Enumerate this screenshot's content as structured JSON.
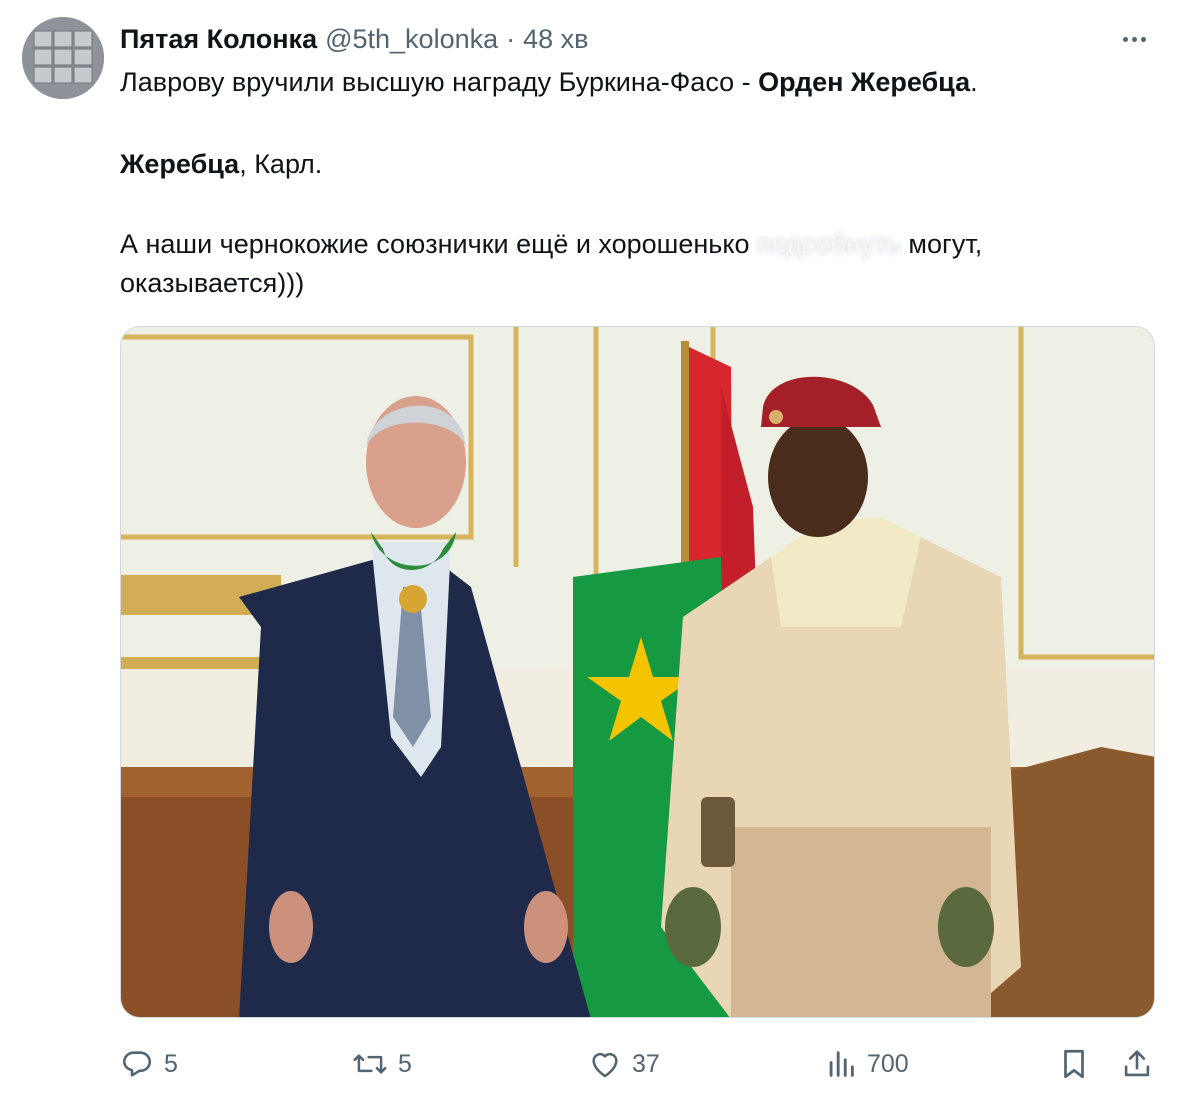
{
  "tweet": {
    "display_name": "Пятая Колонка",
    "handle": "@5th_kolonka",
    "separator": "·",
    "time": "48 хв",
    "line1_prefix": "Лаврову вручили высшую награду Буркина-Фасо - ",
    "line1_bold": "Орден Жеребца",
    "line1_suffix": ".",
    "line2_bold": "Жеребца",
    "line2_suffix": ", Карл.",
    "line3_prefix": "А наши чернокожие союзнички ещё и хорошенько ",
    "line3_spoiler": "подсобнуть",
    "line3_suffix": " могут,",
    "line4": "оказывается)))"
  },
  "actions": {
    "replies": "5",
    "retweets": "5",
    "likes": "37",
    "views": "700"
  },
  "icons": [
    "more-icon",
    "reply-icon",
    "retweet-icon",
    "like-icon",
    "views-icon",
    "bookmark-icon",
    "share-icon"
  ],
  "colors": {
    "text": "#0f1419",
    "secondary": "#536471",
    "border": "#cfd9de",
    "flag_red": "#d7262e",
    "flag_green": "#159a42",
    "flag_star": "#f5c400"
  }
}
